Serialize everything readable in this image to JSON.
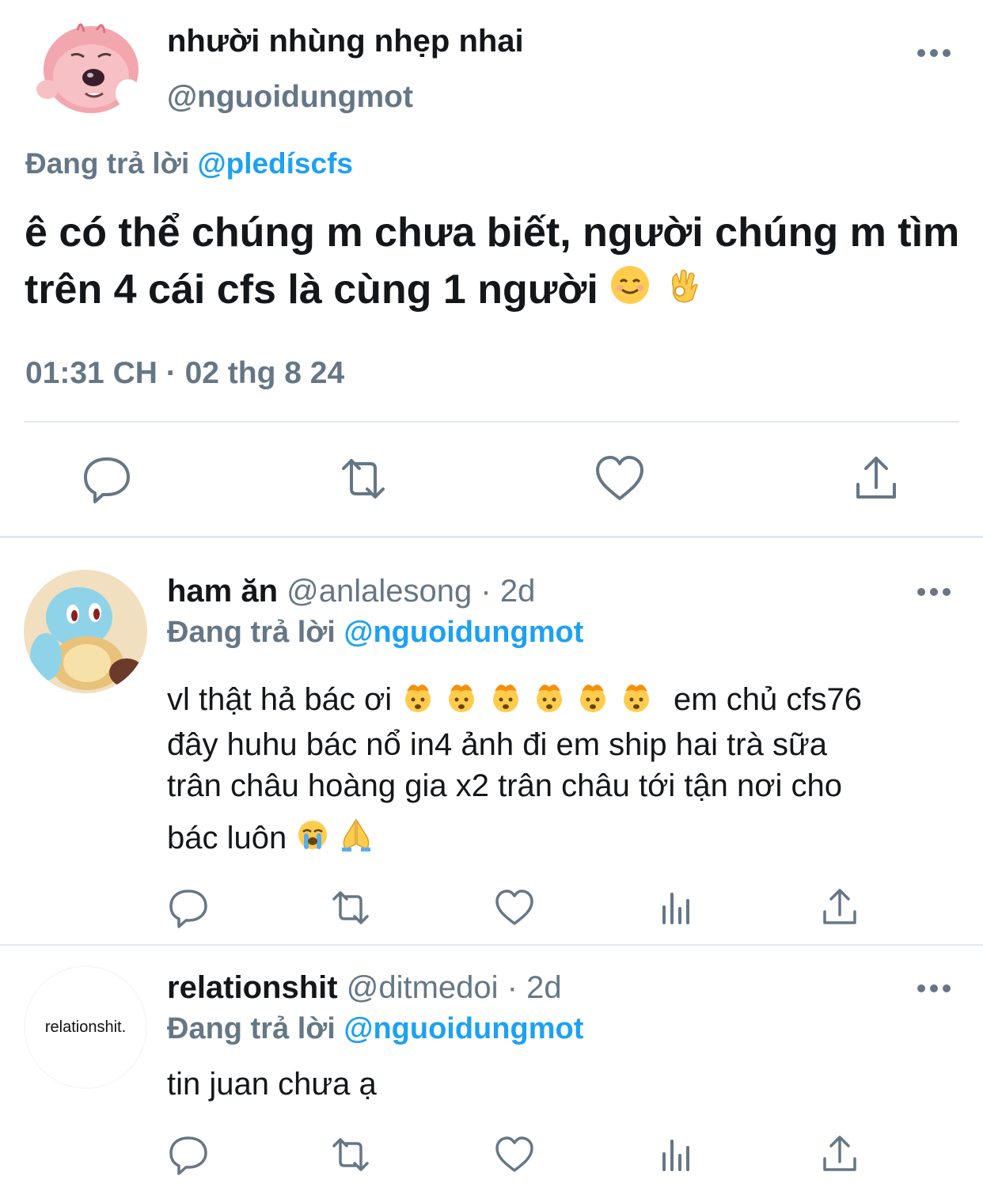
{
  "main_tweet": {
    "display_name": "nhười nhùng nhẹp nhai",
    "handle": "@nguoidungmot",
    "reply_prefix": "Đang trả lời",
    "reply_to": "@pledíscfs",
    "text": "ê có thể chúng m chưa biết, người chúng m tìm trên 4 cái cfs là cùng 1 người",
    "timestamp": "01:31 CH · 02 thg 8 24",
    "avatar_icon": "pink-beaver-avatar"
  },
  "replies": [
    {
      "display_name": "ham ăn",
      "handle": "@anlalesong",
      "time": "· 2d",
      "reply_prefix": "Đang trả lời",
      "reply_to": "@nguoidungmot",
      "line1": "vl thật hả bác ơi",
      "line1b": "em chủ cfs76",
      "line2": "đây huhu bác nổ in4 ảnh đi em ship hai trà sữa",
      "line3": "trân châu hoàng gia x2 trân châu tới tận nơi cho",
      "line4": "bác luôn",
      "avatar_icon": "squirtle-avatar"
    },
    {
      "display_name": "relationshit",
      "handle": "@ditmedoi",
      "time": "· 2d",
      "reply_prefix": "Đang trả lời",
      "reply_to": "@nguoidungmot",
      "text": "tin juan chưa ạ",
      "avatar_text": "relationshit.",
      "avatar_icon": "relationshit-logo-avatar"
    }
  ],
  "colors": {
    "mention": "#1da1f2",
    "secondary": "#657786",
    "text": "#14171a",
    "divider": "#e1e8ed"
  }
}
